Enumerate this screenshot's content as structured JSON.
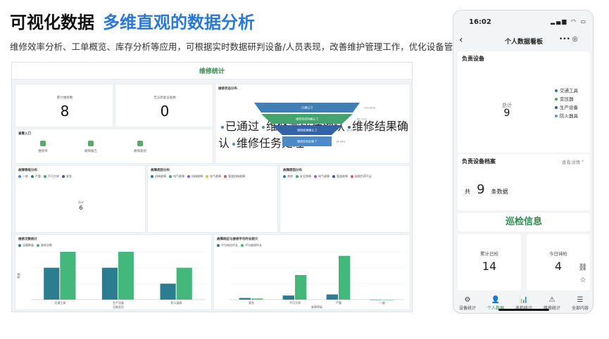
{
  "hero": {
    "title": "可视化数据",
    "title_accent": "多维直观的数据分析",
    "subtitle": "维修效率分析、工单概览、库存分析等应用，可根据实时数据研判设备/人员表现，改善维护管理工作，优化设备管理"
  },
  "dashboard": {
    "title": "维修统计",
    "kpis": [
      {
        "label": "累计维修数",
        "value": "8"
      },
      {
        "label": "无法修复设备数",
        "value": "0"
      }
    ],
    "entry": {
      "title": "查看入口",
      "items": [
        {
          "label": "维修单",
          "icon": "repair-order-icon"
        },
        {
          "label": "故障报告",
          "icon": "fault-report-icon"
        },
        {
          "label": "故障类别",
          "icon": "fault-category-icon"
        }
      ]
    },
    "funnel": {
      "title": "维修状态分布",
      "legend": [
        "已通过",
        "维修完成待确认",
        "维修结果确认",
        "维修任务处理"
      ],
      "labels": [
        "已通过 0",
        "维修完成待确认 1",
        "维修结果确认 2",
        "维修任务处理 7"
      ],
      "percents": [
        "100.00%",
        "85.71%",
        "28.57%",
        "14.29%"
      ],
      "colors": [
        "#3e7fb8",
        "#43a56e",
        "#3464a8",
        "#4a8bc9"
      ]
    }
  },
  "chart_data": [
    {
      "type": "pie",
      "title": "故障等级分布",
      "legend": [
        "一般",
        "严重",
        "不可大修",
        "紧急"
      ],
      "labels": [],
      "values": [],
      "center_label": "总计",
      "center_value": "6",
      "colors": [
        "#3b8fd4",
        "#2c7d8f",
        "#3fa86e",
        "#2d5a9e"
      ]
    },
    {
      "type": "pie",
      "title": "故障类别分布",
      "legend": [
        "机械故障",
        "电气故障",
        "机械故障",
        "电气故障",
        "管道机械故障"
      ],
      "labels": [],
      "values": [],
      "colors": [
        "#2c7d8f",
        "#3fa86e",
        "#8b5cf6",
        "#f2b63c",
        "#e55555"
      ]
    },
    {
      "type": "pie",
      "title": "故障原因分布",
      "legend": [
        "其他",
        "安全隐患",
        "电气故障",
        "管道故障",
        "极限负荷不足"
      ],
      "labels": [],
      "values": [],
      "colors": [
        "#2c7d8f",
        "#3fa86e",
        "#8b5cf6",
        "#2d5a9e",
        "#e55555"
      ]
    },
    {
      "type": "bar",
      "title": "维修次数统计",
      "categories": [
        "交通工具",
        "生产设备",
        "防火器具"
      ],
      "series": [
        {
          "name": "设备数量",
          "values": [
            2,
            2,
            1
          ]
        },
        {
          "name": "维修次数",
          "values": [
            3,
            3,
            2
          ]
        }
      ],
      "ylabel": "数量",
      "xlabel": "设备类型",
      "ylim": [
        0,
        3
      ],
      "colors": [
        "#2c7d8f",
        "#43b87a"
      ]
    },
    {
      "type": "bar",
      "title": "故障响应与维修平均时长统计",
      "categories": [
        "紧急",
        "不可大修",
        "严重",
        "一般"
      ],
      "series": [
        {
          "name": "平均响应时长",
          "values": [
            0.12,
            0.3,
            0.38,
            0
          ]
        },
        {
          "name": "平均维修时长",
          "values": [
            0.08,
            1.8,
            3.2,
            0
          ]
        }
      ],
      "xlabel": "故障等级",
      "ylim": [
        0,
        3.5
      ],
      "colors": [
        "#2c7d8f",
        "#43b87a"
      ]
    },
    {
      "type": "pie",
      "title": "负责设备",
      "legend": [
        "交通工具",
        "变压器",
        "生产设备",
        "防火器具"
      ],
      "labels": [],
      "values": [],
      "center_label": "总计",
      "center_value": "9",
      "colors": [
        "#2c7d8f",
        "#3fa86e",
        "#2d5a9e",
        "#4aa3d8"
      ]
    }
  ],
  "phone": {
    "time": "16:02",
    "status_icons": "▂▄▆ ◠ ▭",
    "nav_title": "个人数据看板",
    "menu": "•••  ◎",
    "devices_title": "负责设备",
    "archive_title": "负责设备档案",
    "archive_link": "查看详情",
    "archive_prefix": "共",
    "archive_count": "9",
    "archive_suffix": "条数据",
    "inspection_title": "巡检信息",
    "stats": [
      {
        "label": "累计已检",
        "value": "14"
      },
      {
        "label": "今日待检",
        "value": "4"
      }
    ],
    "tabs": [
      {
        "label": "设备统计",
        "icon": "⚙"
      },
      {
        "label": "个人数据",
        "icon": "👤"
      },
      {
        "label": "巡检统计",
        "icon": "📊"
      },
      {
        "label": "维修统计",
        "icon": "⚠"
      },
      {
        "label": "全部内容",
        "icon": "☰"
      }
    ]
  }
}
